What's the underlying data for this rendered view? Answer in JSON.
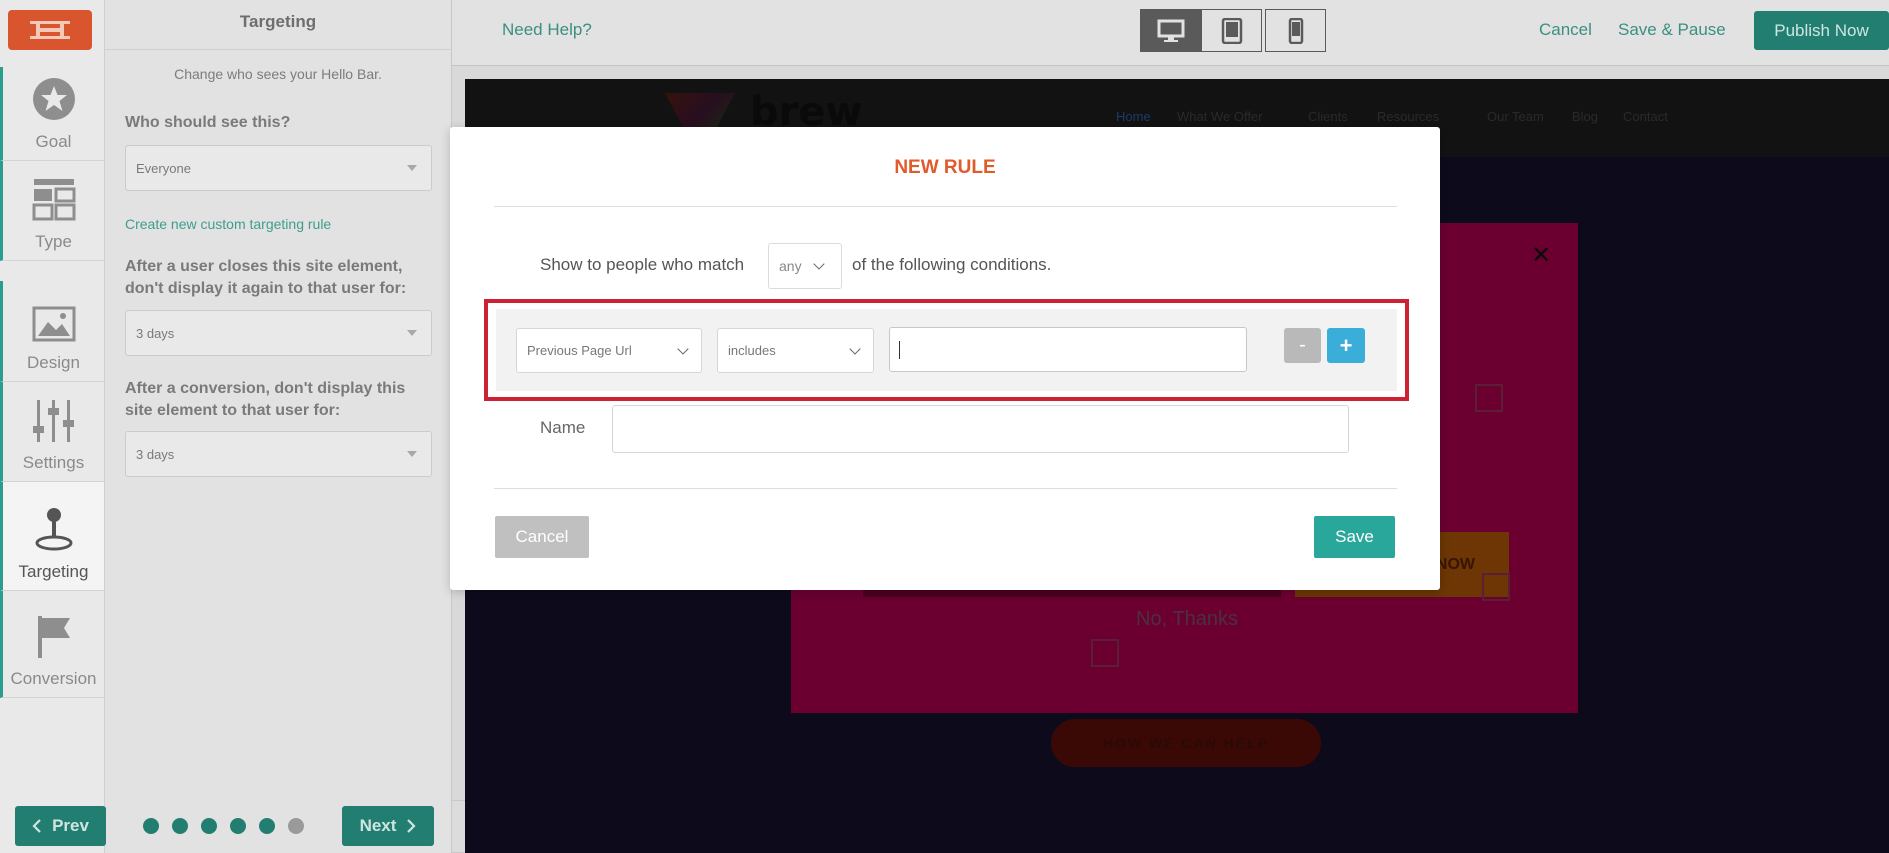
{
  "rail": {
    "items": [
      {
        "label": "Goal",
        "icon": "star-icon"
      },
      {
        "label": "Type",
        "icon": "layout-grid-icon"
      },
      {
        "label": "Design",
        "icon": "image-icon"
      },
      {
        "label": "Settings",
        "icon": "sliders-icon"
      },
      {
        "label": "Targeting",
        "icon": "joystick-icon"
      },
      {
        "label": "Conversion",
        "icon": "flag-icon"
      }
    ],
    "active": "Targeting"
  },
  "panel": {
    "title": "Targeting",
    "subtitle": "Change who sees your Hello Bar.",
    "who_label": "Who should see this?",
    "who_value": "Everyone",
    "custom_rule_link": "Create new custom targeting rule",
    "close_label": "After a user closes this site element, don't display it again to that user for:",
    "close_value": "3 days",
    "conversion_label": "After a conversion, don't display this site element to that user for:",
    "conversion_value": "3 days"
  },
  "bottom_nav": {
    "prev": "Prev",
    "next": "Next",
    "steps_total": 6,
    "steps_done": 5
  },
  "topbar": {
    "need_help": "Need Help?",
    "devices": [
      "desktop-icon",
      "tablet-icon",
      "mobile-icon"
    ],
    "active_device": "desktop",
    "cancel": "Cancel",
    "save_pause": "Save & Pause",
    "publish": "Publish Now"
  },
  "preview": {
    "brand": "brew",
    "nav": [
      "Home",
      "What We Offer",
      "Clients",
      "Resources",
      "Our Team",
      "Blog",
      "Contact"
    ],
    "cta_partial": "NOW",
    "no_thanks": "No, Thanks",
    "help_button": "HOW WE CAN HELP"
  },
  "modal": {
    "title": "NEW RULE",
    "match_prefix": "Show to people who match",
    "match_value": "any",
    "match_suffix": "of the following conditions.",
    "condition": {
      "field": "Previous Page Url",
      "operator": "includes",
      "value": ""
    },
    "minus_label": "-",
    "plus_label": "+",
    "name_label": "Name",
    "name_value": "",
    "cancel": "Cancel",
    "save": "Save"
  },
  "colors": {
    "teal": "#237e72",
    "orange_title": "#e05a2a",
    "save_teal": "#2aa79b",
    "plus_blue": "#3aaed8",
    "highlight_red": "#cc2233"
  }
}
